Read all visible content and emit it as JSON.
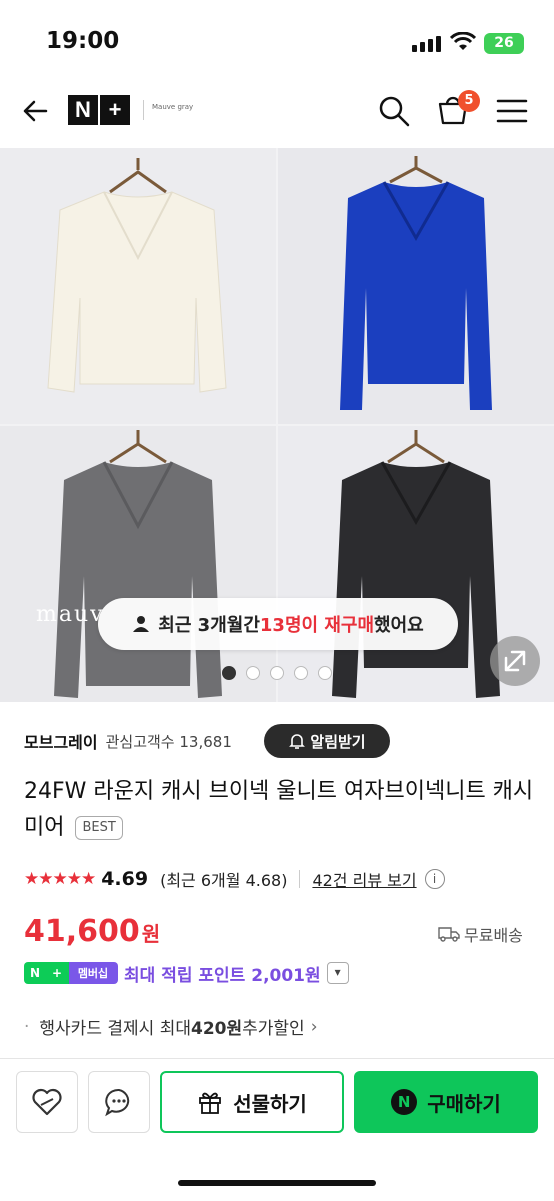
{
  "status_bar": {
    "time": "19:00",
    "battery": "26"
  },
  "nav": {
    "logo_n": "N",
    "logo_plus": "+",
    "brand_small": "Mauve gray",
    "cart_count": "5"
  },
  "hero": {
    "watermark": "mauv",
    "popup": {
      "prefix": "최근 3개월간 ",
      "highlight": "13명이 재구매",
      "suffix": " 했어요"
    },
    "dots_total": 5,
    "dots_active": 1
  },
  "store": {
    "name": "모브그레이",
    "followers": "관심고객수 13,681",
    "alarm_label": "알림받기"
  },
  "product": {
    "title": "24FW 라운지 캐시 브이넥 울니트 여자브이넥니트 캐시미어",
    "badge": "BEST"
  },
  "rating": {
    "stars": "★★★★★",
    "score": "4.69",
    "recent": "(최근 6개월 4.68)",
    "reviews_link": "42건 리뷰 보기",
    "info": "i",
    "value": 4.69
  },
  "price": {
    "amount": "41,600",
    "unit": "원",
    "shipping": "무료배송"
  },
  "membership": {
    "n_label": "N",
    "plus_label": "+",
    "member_label": "멤버십",
    "points_text": "최대 적립 포인트 2,001원"
  },
  "benefit": {
    "text_prefix": "행사카드 결제시 최대 ",
    "amount": "420원",
    "text_suffix": " 추가할인"
  },
  "bottom_bar": {
    "gift_label": "선물하기",
    "buy_icon": "N",
    "buy_label": "구매하기"
  },
  "colors": {
    "accent_red": "#e8303a",
    "naver_green": "#0ec65a",
    "member_purple": "#7a4ee0"
  }
}
